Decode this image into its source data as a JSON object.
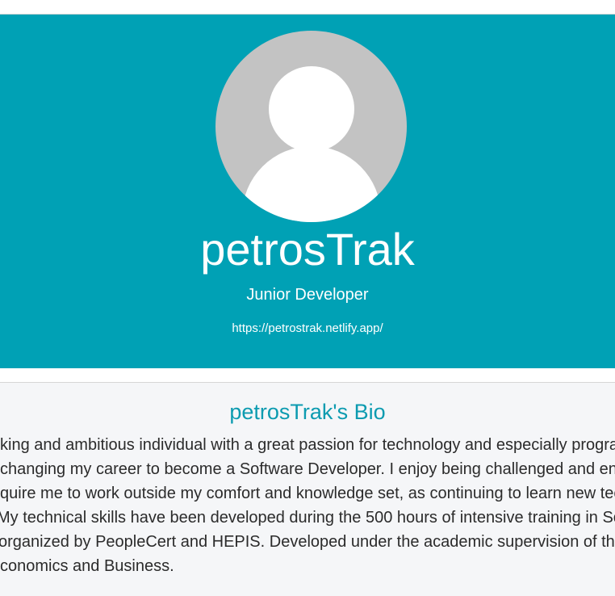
{
  "profile": {
    "avatar_icon": "user-avatar-placeholder-icon",
    "name": "petrosTrak",
    "role": "Junior Developer",
    "url": "https://petrostrak.netlify.app/"
  },
  "bio": {
    "title": "petrosTrak's Bio",
    "lines": [
      "king and ambitious individual with a great passion for technology and especially progra",
      "changing my career to become a Software Developer. I enjoy being challenged and en",
      "quire me to work outside my comfort and knowledge set, as continuing to learn new tec",
      "My technical skills have been developed during the 500 hours of intensive training in So",
      "organized by PeopleCert and HEPIS. Developed under the academic supervision of the",
      "conomics and Business."
    ]
  },
  "colors": {
    "hero_background": "#00a1b5",
    "bio_title": "#0c9bb0",
    "bio_background": "#f5f6f8"
  }
}
